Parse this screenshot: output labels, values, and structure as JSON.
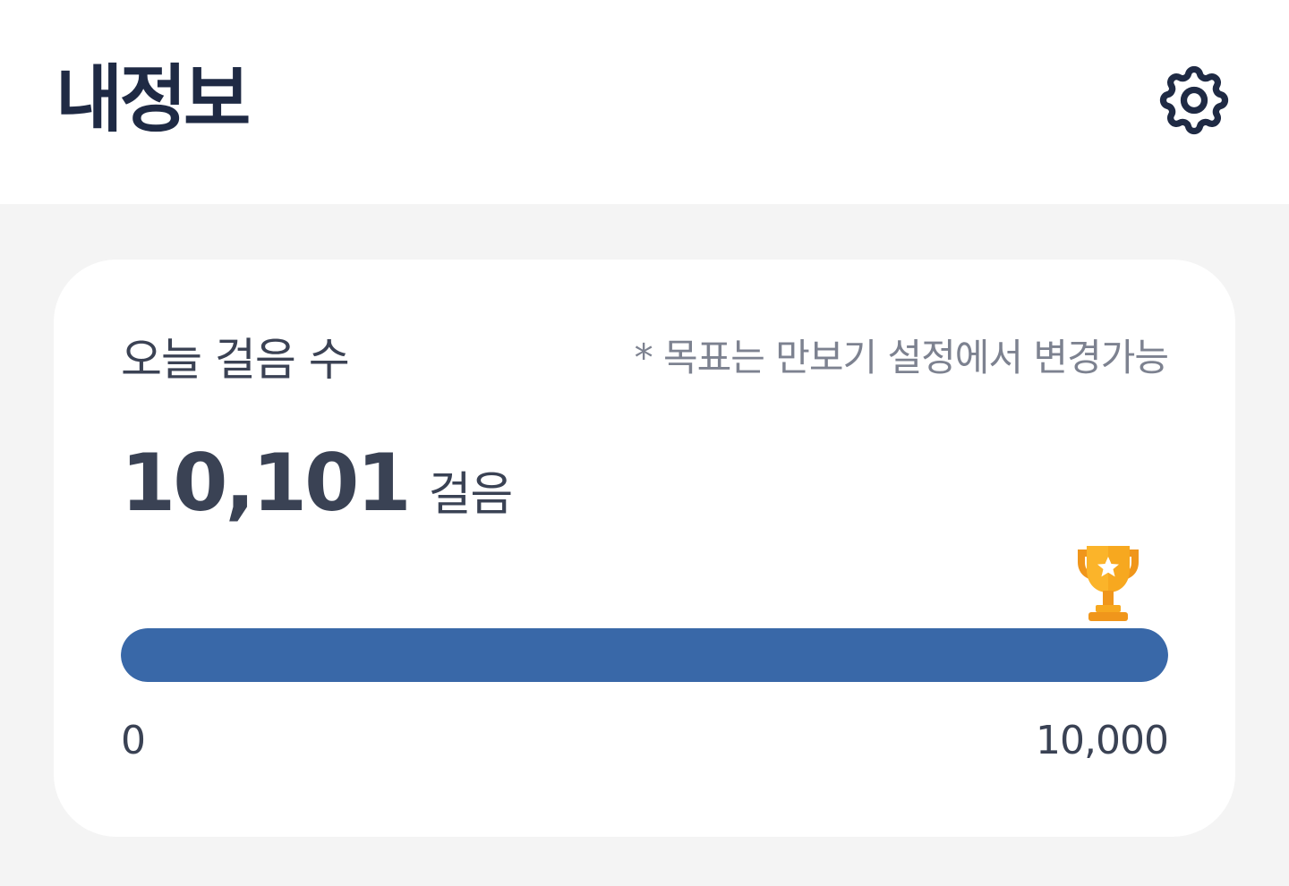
{
  "header": {
    "title": "내정보",
    "settings_icon": "gear-icon"
  },
  "steps_card": {
    "label": "오늘 걸음 수",
    "goal_note": "* 목표는 만보기 설정에서 변경가능",
    "count": "10,101",
    "unit": "걸음",
    "progress_fraction": 1.0,
    "scale_min": "0",
    "scale_max": "10,000",
    "trophy_icon": "trophy-icon"
  },
  "colors": {
    "title": "#1f2a44",
    "progress_fill": "#3968a8",
    "trophy": "#f5a623",
    "background": "#f4f4f4"
  }
}
